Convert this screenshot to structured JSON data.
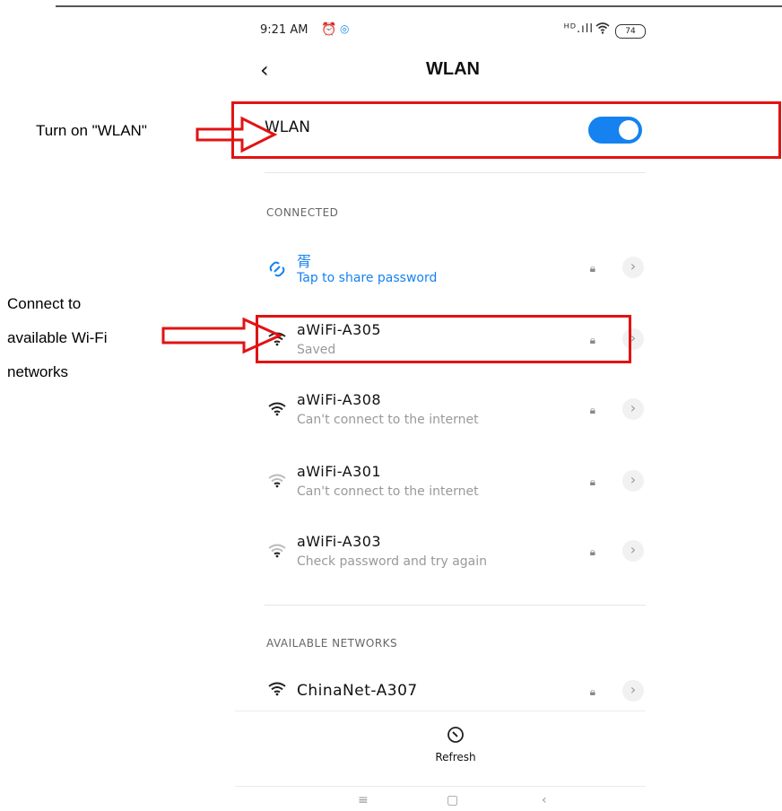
{
  "status_bar": {
    "time": "9:21 AM",
    "alarm_icon": "alarm-clock-icon",
    "signal_text": "ᴴᴰ.ıll",
    "wifi_icon": "wifi-icon",
    "battery": "74"
  },
  "header": {
    "back_icon": "chevron-left-icon",
    "title": "WLAN"
  },
  "wlan_toggle": {
    "label": "WLAN",
    "state": "on",
    "color": "#1582f0"
  },
  "sections": {
    "connected": "CONNECTED",
    "available": "AVAILABLE NETWORKS"
  },
  "connected_network": {
    "name": "胥",
    "status": "Tap to share password"
  },
  "saved_networks": [
    {
      "name": "aWiFi-A305",
      "status": "Saved"
    },
    {
      "name": "aWiFi-A308",
      "status": "Can't connect to the internet"
    },
    {
      "name": "aWiFi-A301",
      "status": "Can't connect to the internet"
    },
    {
      "name": "aWiFi-A303",
      "status": "Check password and try again"
    }
  ],
  "available_networks": [
    {
      "name": "ChinaNet-A307"
    }
  ],
  "refresh": {
    "label": "Refresh",
    "icon": "refresh-icon"
  },
  "annotations": {
    "turn_on": "Turn on \"WLAN\"",
    "connect": [
      "Connect to",
      "available Wi-Fi",
      "networks"
    ],
    "highlight_color": "#e21313"
  }
}
